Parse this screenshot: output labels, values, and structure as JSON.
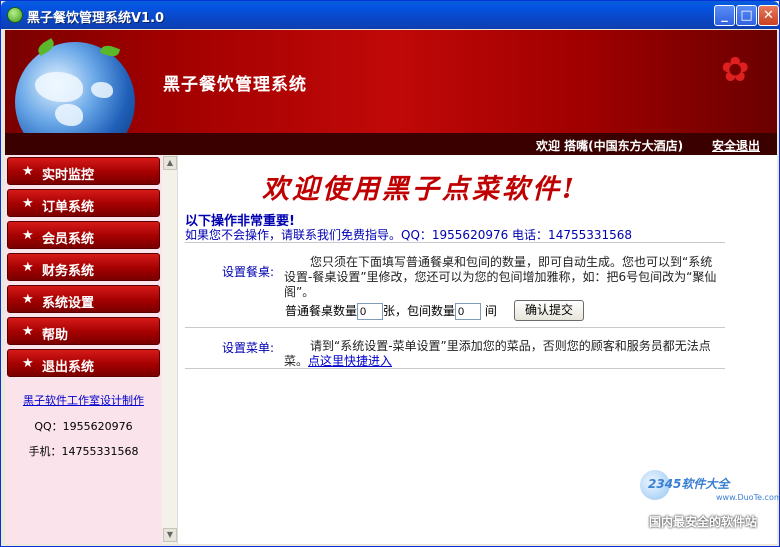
{
  "window": {
    "title": "黑子餐饮管理系统V1.0",
    "buttons": {
      "minimize": "_",
      "maximize": "□",
      "close": "✕"
    }
  },
  "header": {
    "brand_title": "黑子餐饮管理系统",
    "welcome_text": "欢迎 搭嘴(中国东方大酒店)",
    "logout_label": "安全退出"
  },
  "sidebar": {
    "items": [
      {
        "label": "实时监控",
        "icon": "star-icon"
      },
      {
        "label": "订单系统",
        "icon": "star-icon"
      },
      {
        "label": "会员系统",
        "icon": "star-icon"
      },
      {
        "label": "财务系统",
        "icon": "star-icon"
      },
      {
        "label": "系统设置",
        "icon": "star-icon"
      },
      {
        "label": "帮助",
        "icon": "star-icon"
      },
      {
        "label": "退出系统",
        "icon": "star-icon"
      }
    ],
    "credit_link": "黑子软件工作室设计制作",
    "qq": "QQ：1955620976",
    "phone": "手机：14755331568"
  },
  "main": {
    "title": "欢迎使用黑子点菜软件!",
    "important": "以下操作非常重要!",
    "contact": "如果您不会操作，请联系我们免费指导。QQ：1955620976 电话：14755331568",
    "table_section": {
      "label": "设置餐桌:",
      "text": "您只须在下面填写普通餐桌和包间的数量，即可自动生成。您也可以到“系统设置-餐桌设置”里修改，您还可以为您的包间增加雅称，如：把6号包间改为“聚仙阁”。",
      "normal_label": "普通餐桌数量",
      "normal_value": "0",
      "normal_unit": "张，包间数量",
      "room_value": "0",
      "room_unit": "间",
      "submit_label": "确认提交"
    },
    "menu_section": {
      "label": "设置菜单:",
      "text": "请到“系统设置-菜单设置”里添加您的菜品，否则您的顾客和服务员都无法点菜。",
      "link": "点这里快捷进入"
    }
  },
  "watermark": {
    "brand": "2345软件大全",
    "url": "www.DuoTe.com",
    "slogan": "国内最安全的软件站"
  }
}
